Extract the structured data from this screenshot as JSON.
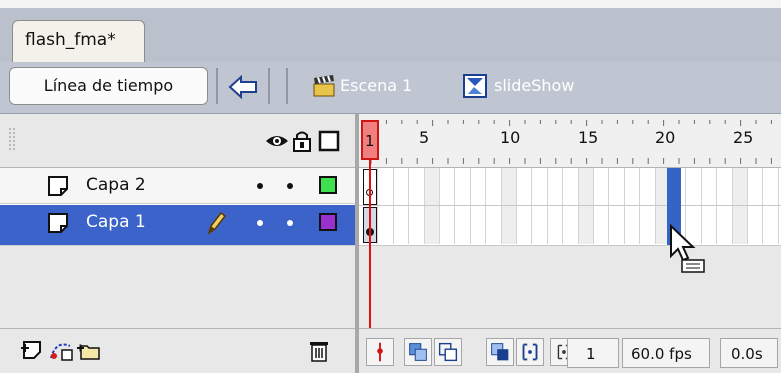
{
  "document": {
    "tab_title": "flash_fma*"
  },
  "scene_bar": {
    "timeline_button": "Línea de tiempo",
    "back_icon": "back-arrow-icon",
    "scene_label": "Escena 1",
    "symbol_label": "slideShow"
  },
  "layers_header": {
    "icons": [
      "eye-icon",
      "lock-icon",
      "outline-icon"
    ]
  },
  "ruler": {
    "frame_numbers": [
      "5",
      "10",
      "15",
      "20",
      "25"
    ],
    "current_frame": "1"
  },
  "layers": [
    {
      "name": "Capa 2",
      "selected": false,
      "outline_color": "#3fe04f"
    },
    {
      "name": "Capa 1",
      "selected": true,
      "outline_color": "#9932cc"
    }
  ],
  "footer": {
    "left_icons": [
      "insert-layer-icon",
      "add-motion-guide-icon",
      "insert-layer-folder-icon"
    ],
    "delete_icon": "trash-icon",
    "frame_value": "1",
    "frame_rate": "60.0 fps",
    "elapsed_time": "0.0s"
  },
  "colors": {
    "selection": "#3c63c9",
    "playhead": "#e01010"
  }
}
